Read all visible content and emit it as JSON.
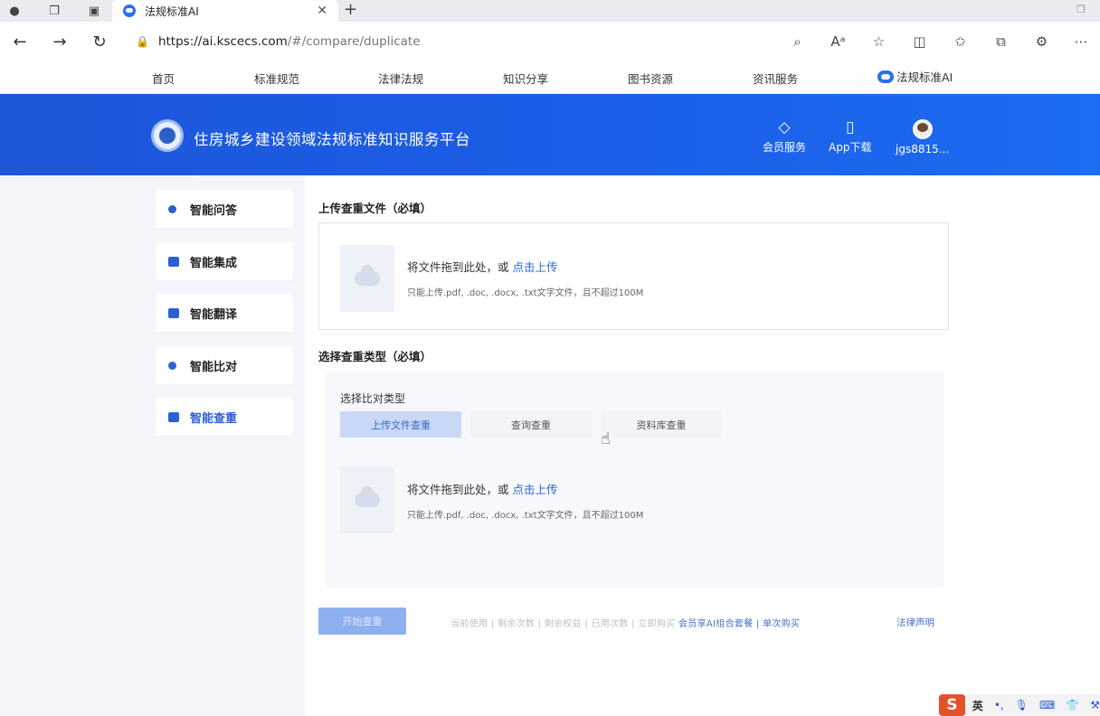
{
  "browser": {
    "tab_title": "法规标准AI",
    "tab_close": "✕",
    "new_tab": "+",
    "url_host": "https://ai.kscecs.com",
    "url_path": "/#/compare/duplicate"
  },
  "site_nav": {
    "items": [
      "首页",
      "标准规范",
      "法律法规",
      "知识分享",
      "图书资源",
      "资讯服务"
    ],
    "ai_label": "法规标准AI"
  },
  "banner": {
    "title": "住房城乡建设领域法规标准知识服务平台",
    "member_label": "会员服务",
    "app_label": "App下载",
    "user_label": "jgs8815..."
  },
  "sidebar": {
    "items": [
      {
        "label": "智能问答",
        "active": false
      },
      {
        "label": "智能集成",
        "active": false
      },
      {
        "label": "智能翻译",
        "active": false
      },
      {
        "label": "智能比对",
        "active": false
      },
      {
        "label": "智能查重",
        "active": true
      }
    ]
  },
  "main": {
    "upload_section_title": "上传查重文件（必填）",
    "upload1_main": "将文件拖到此处，或",
    "upload1_link": "点击上传",
    "upload1_sub": "只能上传.pdf, .doc, .docx, .txt文字文件，且不超过100M",
    "type_section_title": "选择查重类型（必填）",
    "type_label": "选择比对类型",
    "type_buttons": [
      "上传文件查重",
      "查询查重",
      "资料库查重"
    ],
    "upload2_main": "将文件拖到此处，或",
    "upload2_link": "点击上传",
    "upload2_sub": "只能上传.pdf, .doc, .docx, .txt文字文件，且不超过100M",
    "start_button": "开始查重",
    "quota_text": "当前使用 | 剩余次数 | 剩余权益 | 已用次数 | 立即购买",
    "quota_link": "会员享AI组合套餐 | 单次购买",
    "legal_link": "法律声明"
  },
  "ime": {
    "logo": "S",
    "lang": "英"
  }
}
